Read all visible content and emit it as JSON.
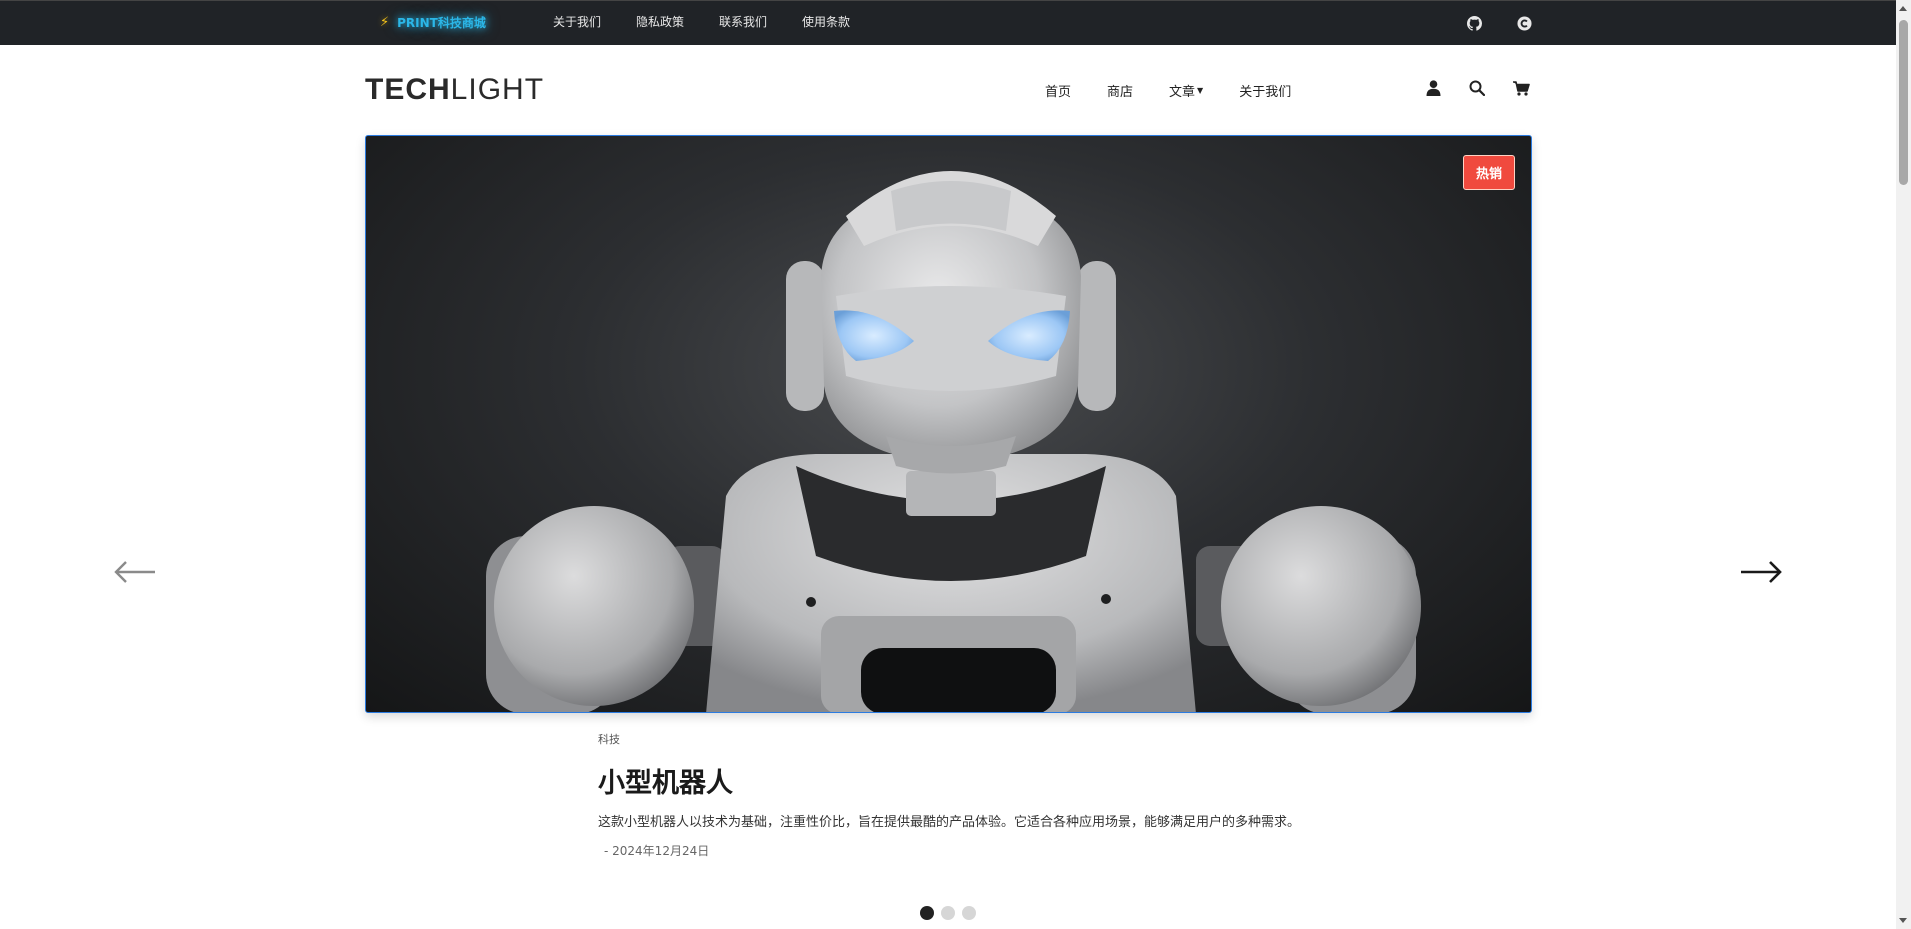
{
  "topbar": {
    "brand": "PRINT科技商城",
    "links": [
      "关于我们",
      "隐私政策",
      "联系我们",
      "使用条款"
    ],
    "icons": [
      "github-icon",
      "copyright-icon"
    ]
  },
  "header": {
    "logo_bold": "TECH",
    "logo_light": "LIGHT",
    "nav": [
      "首页",
      "商店",
      "文章",
      "关于我们"
    ],
    "icons": [
      "user-icon",
      "search-icon",
      "cart-icon"
    ]
  },
  "hero": {
    "badge": "热销",
    "category": "科技",
    "title": "小型机器人",
    "description": "这款小型机器人以技术为基础，注重性价比，旨在提供最酷的产品体验。它适合各种应用场景，能够满足用户的多种需求。",
    "date": "- 2024年12月24日"
  },
  "carousel": {
    "slide_count": 3,
    "active_index": 0
  },
  "colors": {
    "topbar_bg": "#202327",
    "brand_glow": "#2bb7e8",
    "badge_bg": "#f04a3e",
    "hero_border": "#2b7be0"
  }
}
